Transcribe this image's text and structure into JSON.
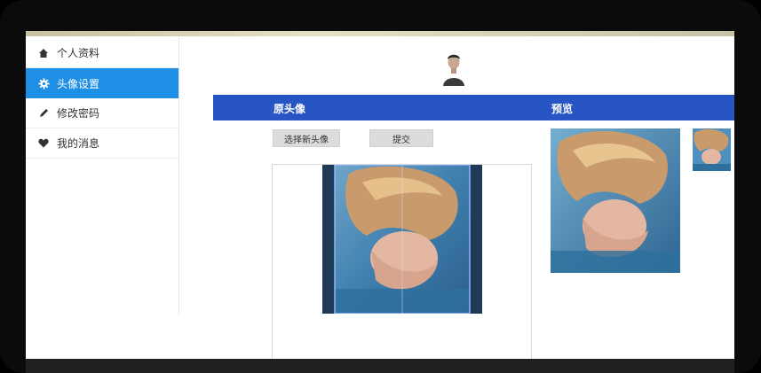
{
  "sidebar": {
    "items": [
      {
        "label": "个人资料",
        "icon": "home-icon"
      },
      {
        "label": "头像设置",
        "icon": "gear-icon",
        "active": true
      },
      {
        "label": "修改密码",
        "icon": "pencil-icon"
      },
      {
        "label": "我的消息",
        "icon": "heart-icon"
      }
    ]
  },
  "header": {
    "left_title": "原头像",
    "right_title": "预览"
  },
  "actions": {
    "choose_label": "选择新头像",
    "submit_label": "提交"
  },
  "colors": {
    "accent": "#1f8fe6",
    "band": "#2855c4"
  }
}
